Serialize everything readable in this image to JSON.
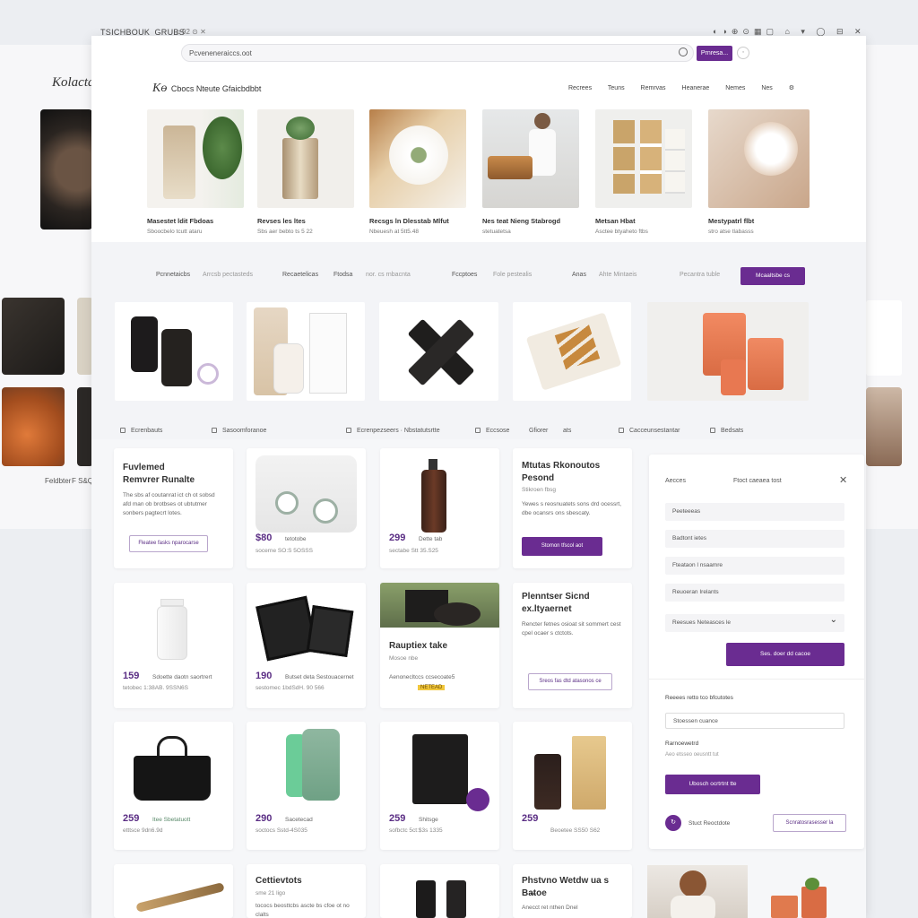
{
  "background_page": {
    "logo": "Kolactai",
    "captions": [
      "Feldbter",
      "F S&Q"
    ]
  },
  "top_strip": {
    "tab_title": "TSICHBOUK_GRUBS",
    "tab_icons": "⌂ 92 ⊙ ✕"
  },
  "browser": {
    "address": "Pcveneneraiccs.oot",
    "go_label": "Prnresa..."
  },
  "header": {
    "brand_logo": "Kɵ",
    "brand_name": "Cbocs Nteute Gfaicbdbbt",
    "nav": [
      "Recrees",
      "Teuns",
      "Remrvas",
      "Heanerae",
      "Nemes",
      "Nes"
    ]
  },
  "featured": [
    {
      "title": "Masestet ldit Fbdoas",
      "sub": "Sboocbelo tcutt ataru"
    },
    {
      "title": "Revses les ltes",
      "sub": "Sbs aer bebto ts 5 22"
    },
    {
      "title": "Recsgs ln Dlesstab Mlfut",
      "sub": "Nbeuesh at 5tt5.48"
    },
    {
      "title": "Nes teat Nieng Stabrogd",
      "sub": "stetuatetsa"
    },
    {
      "title": "Metsan Hbat",
      "sub": "Asctee btyaheto ftbs"
    },
    {
      "title": "Mestypatrl flbt",
      "sub": "stro atse tlabasss"
    }
  ],
  "filter_bar": {
    "items": [
      "Pcnnetaicbs",
      "Arrcsb pectasteds",
      "Recaetelicas",
      "Ftodsa",
      "nor. cs rnbacnta",
      "Fccptoes",
      "Fole pestealis",
      "Anas",
      "Ahte Mintaeis",
      "Pecantra tuble"
    ],
    "button": "Mcaaltsbe cs"
  },
  "tag_row": [
    "Ecrenbauts",
    "Sasoomforanoe",
    "Ecrenpezseers · Nbstatutsrtte",
    "Eccsose",
    "Gfiorer",
    "ats",
    "Cacceunsestantar",
    "Bedsats"
  ],
  "products": [
    {
      "type": "text",
      "title": "Fuvlemed Remvrer Runalte",
      "desc": "The sbs af coutanrat ict ch ot sobsd afd man ob brotbses ot ubtutmer sonbers pagtecrt lotes.",
      "button": "Fleatee fasks nparocarse"
    },
    {
      "price": "$80",
      "meta": "tetotobe",
      "sub": "socerne SO:S 5OSSS"
    },
    {
      "price": "299",
      "meta": "Dette tab",
      "sub": "sectabe Stt 35.S25"
    },
    {
      "type": "text",
      "title": "Mtutas Rkonoutos Pesond",
      "sub": "Stikroen fbsg",
      "desc": "Yewes s reosnuatets sons drd ocessrt, dbe ocansrs ons sbescaty.",
      "button": "Stomon tfscol aot"
    },
    {
      "price": "159",
      "meta": "Sdoette daotn saortrert",
      "sub": "tetobec 1:38AB. 9SSN6S"
    },
    {
      "price": "190",
      "meta": "Butset deta Sestouacernet",
      "sub": "sestomec 1bdSdH. 90 566"
    },
    {
      "title": "Rauptiex take",
      "meta": "Mosoe nbe",
      "sub": "Aenonecltccs ccsecoate5",
      "badge": "NETEAD"
    },
    {
      "type": "text",
      "title": "Plenntser Sicnd ex.ltyaernet",
      "desc": "Rencter fetnes osioat sit sommert cest cpel ocaer s ctctots.",
      "button": "Sreos fas dtd atasonos ce"
    },
    {
      "price": "259",
      "meta": "Itee Sbetatuott",
      "sub": "etttsce 9dn6.9d"
    },
    {
      "price": "290",
      "meta": "Sacetecad",
      "sub": "soctocs Sstd-4S035"
    },
    {
      "price": "259",
      "meta": "Shitsge",
      "sub": "sofbctc 5ct:$3s  1335"
    },
    {
      "price": "259",
      "meta": "",
      "sub": "Beoetee SS50 S62"
    },
    {
      "title": "",
      "price": ""
    },
    {
      "title": "Cettievtots",
      "sub": "sme 21 ligo",
      "desc": "tococs beosttcbs ascte bs cfoe ot no clalts"
    },
    {
      "title": ""
    },
    {
      "title": "Phstvno Wetdw ua s Ba̶toe",
      "desc": "Anecct ret nthen Dnel"
    }
  ],
  "panel": {
    "left_label": "Aecces",
    "right_label": "Ftoct caeaea tost",
    "fields": [
      "Peeteeeas",
      "Badtont ietes",
      "Fteataon l nsaamre",
      "Reuoeran Irelants"
    ],
    "select_value": "Reesues Neteasces le",
    "apply_button": "Ses. doer dd cacoe",
    "section_label": "Reeees retto tco bfcutotes",
    "input_value": "Stoessen cuance",
    "label2": "Rarnoewetrd",
    "hint2": "Aeo etsseo oeusntt tut",
    "submit_button": "Ubosch ocrtrtnt tte",
    "footer_label": "Stuct Reoctdote",
    "footer_button": "Scnratosrasesser la"
  },
  "colors": {
    "accent": "#6a2c91",
    "price": "#5a2d84",
    "badge": "#f1c73c"
  }
}
